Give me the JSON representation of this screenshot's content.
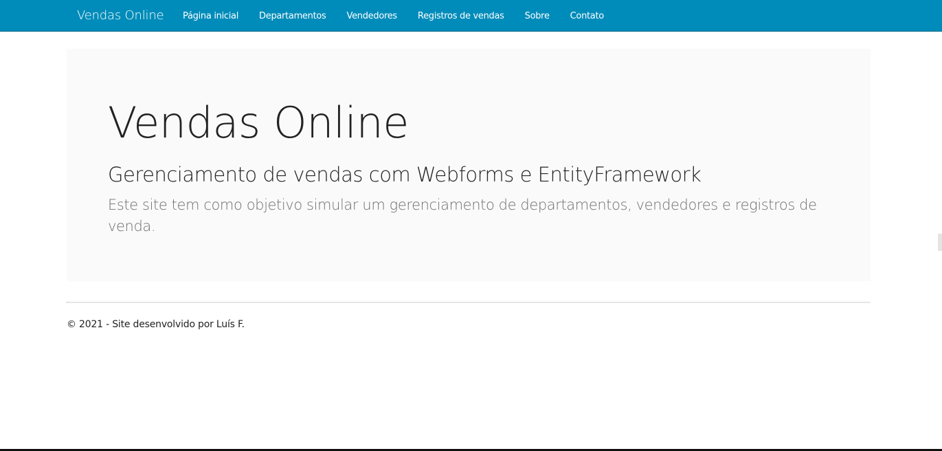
{
  "navbar": {
    "brand": "Vendas Online",
    "items": [
      {
        "label": "Página inicial"
      },
      {
        "label": "Departamentos"
      },
      {
        "label": "Vendedores"
      },
      {
        "label": "Registros de vendas"
      },
      {
        "label": "Sobre"
      },
      {
        "label": "Contato"
      }
    ],
    "color": "#008cba"
  },
  "jumbotron": {
    "title": "Vendas Online",
    "subtitle": "Gerenciamento de vendas com Webforms e EntityFramework",
    "description": "Este site tem como objetivo simular um gerenciamento de departamentos, vendedores e registros de venda."
  },
  "footer": {
    "text": "© 2021 - Site desenvolvido por Luís F."
  }
}
